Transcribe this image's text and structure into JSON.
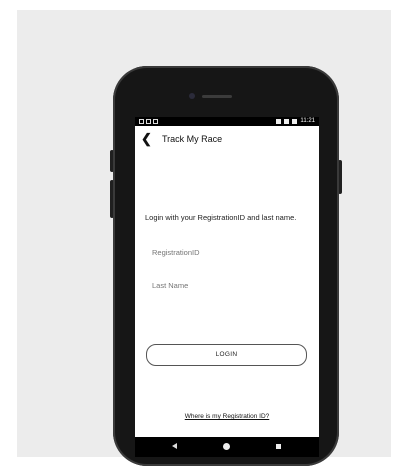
{
  "status_bar": {
    "time": "11:21"
  },
  "app_bar": {
    "title": "Track My Race"
  },
  "login": {
    "instruction": "Login with your RegistrationID and last name.",
    "registration_placeholder": "RegistrationID",
    "last_name_placeholder": "Last Name",
    "button_label": "LOGIN",
    "help_link": "Where is my Registration ID?"
  }
}
